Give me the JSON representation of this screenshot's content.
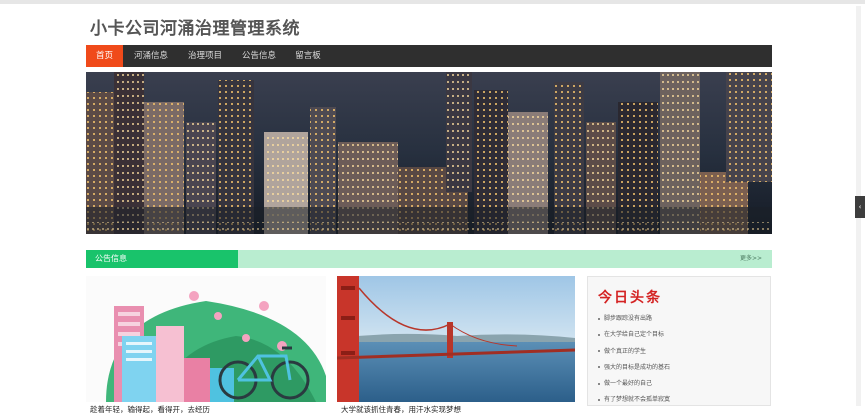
{
  "app": {
    "title": "小卡公司河涌治理管理系统"
  },
  "nav": {
    "items": [
      {
        "label": "首页",
        "active": true
      },
      {
        "label": "河涌信息",
        "active": false
      },
      {
        "label": "治理项目",
        "active": false
      },
      {
        "label": "公告信息",
        "active": false
      },
      {
        "label": "留言板",
        "active": false
      }
    ]
  },
  "section": {
    "title": "公告信息",
    "more": "更多>>"
  },
  "cards": [
    {
      "caption": "趁着年轻，输得起，看得开，去经历"
    },
    {
      "caption": "大学就该抓住青春，用汗水实现梦想"
    }
  ],
  "news": {
    "title": "今日头条",
    "items": [
      "脚步跟踪没有出路",
      "在大学给自己定个目标",
      "做个真正的学生",
      "强大的目标是成功的基石",
      "做一个最好的自己",
      "有了梦想就不会孤单寂寞"
    ]
  },
  "colors": {
    "nav_bg": "#2f2f2f",
    "nav_active": "#f04a1a",
    "section_green": "#19c36b",
    "section_light": "#b9edd0",
    "headline_red": "#d42323"
  },
  "icons": {
    "side_handle": "chevron-left-icon"
  }
}
